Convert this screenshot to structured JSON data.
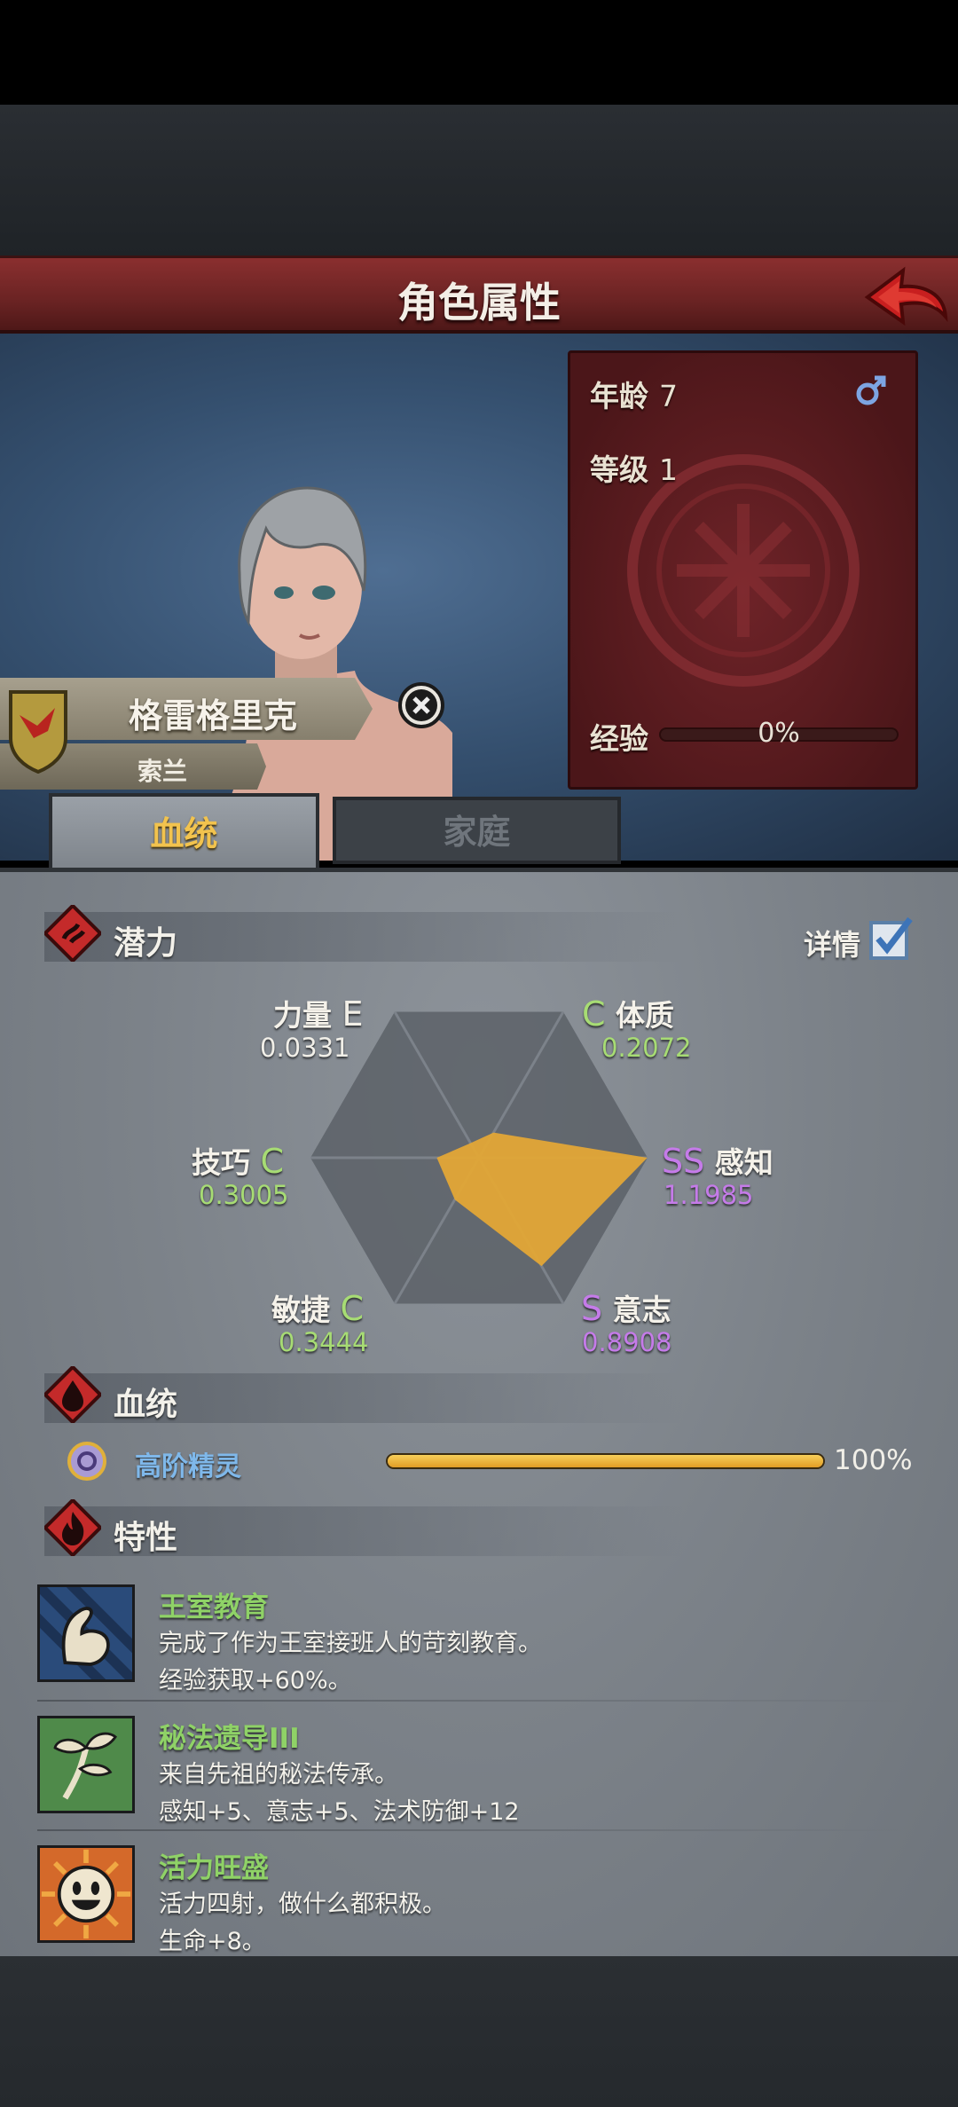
{
  "header": {
    "title": "角色属性"
  },
  "character": {
    "name": "格雷格里克",
    "origin": "索兰",
    "age_label": "年龄",
    "age": "7",
    "level_label": "等级",
    "level": "1",
    "exp_label": "经验",
    "exp_percent": "0%",
    "exp_fraction": 0.0,
    "gender": "male"
  },
  "tabs": [
    {
      "label": "血统",
      "active": true
    },
    {
      "label": "家庭",
      "active": false
    }
  ],
  "potential": {
    "title": "潜力",
    "detail_label": "详情",
    "detail_checked": true,
    "stats": [
      {
        "name": "力量",
        "grade": "E",
        "value": "0.0331"
      },
      {
        "name": "体质",
        "grade": "C",
        "value": "0.2072"
      },
      {
        "name": "感知",
        "grade": "SS",
        "value": "1.1985"
      },
      {
        "name": "意志",
        "grade": "S",
        "value": "0.8908"
      },
      {
        "name": "敏捷",
        "grade": "C",
        "value": "0.3444"
      },
      {
        "name": "技巧",
        "grade": "C",
        "value": "0.3005"
      }
    ]
  },
  "chart_data": {
    "type": "radar",
    "axes": [
      "力量",
      "体质",
      "感知",
      "意志",
      "敏捷",
      "技巧"
    ],
    "values": [
      0.0331,
      0.2072,
      1.1985,
      0.8908,
      0.3444,
      0.3005
    ],
    "max": 1.2,
    "fill_color": "#e3a636"
  },
  "bloodline": {
    "title": "血统",
    "name": "高阶精灵",
    "percent": "100%",
    "fraction": 1.0
  },
  "traits": {
    "title": "特性",
    "items": [
      {
        "name": "王室教育",
        "desc": "完成了作为王室接班人的苛刻教育。",
        "effect": "经验获取+60%。",
        "icon": "flexed-arm-icon"
      },
      {
        "name": "秘法遗导III",
        "desc": "来自先祖的秘法传承。",
        "effect": "感知+5、意志+5、法术防御+12",
        "icon": "sprout-icon"
      },
      {
        "name": "活力旺盛",
        "desc": "活力四射，做什么都积极。",
        "effect": "生命+8。",
        "icon": "smiley-icon"
      }
    ]
  },
  "colors": {
    "header_red": "#7a2828",
    "grade_green": "#a7dc74",
    "grade_purple": "#c57be9",
    "trait_green": "#8fd267",
    "bloodline_blue": "#7fb8ea",
    "tab_active_gold": "#f2c34e"
  }
}
